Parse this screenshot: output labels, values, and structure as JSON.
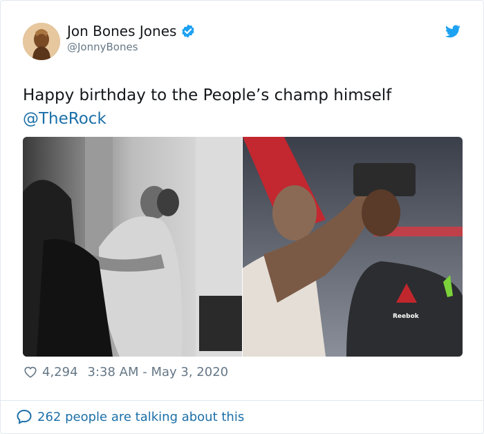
{
  "tweet": {
    "author_name": "Jon Bones Jones",
    "author_handle": "@JonnyBones",
    "text": "Happy birthday to the People’s champ himself",
    "mention": "@TheRock",
    "likes": "4,294",
    "timestamp": "3:38 AM - May 3, 2020",
    "conversation": "262 people are talking about this",
    "images": [
      {
        "text": ""
      },
      {
        "text": "Reebok"
      }
    ]
  },
  "colors": {
    "link": "#1b6fa8",
    "twitter_blue": "#1da1f2",
    "muted": "#657786",
    "border": "#e1e8ed"
  },
  "icons": [
    "verified-badge-icon",
    "twitter-bird-icon",
    "heart-icon",
    "speech-bubble-icon"
  ]
}
